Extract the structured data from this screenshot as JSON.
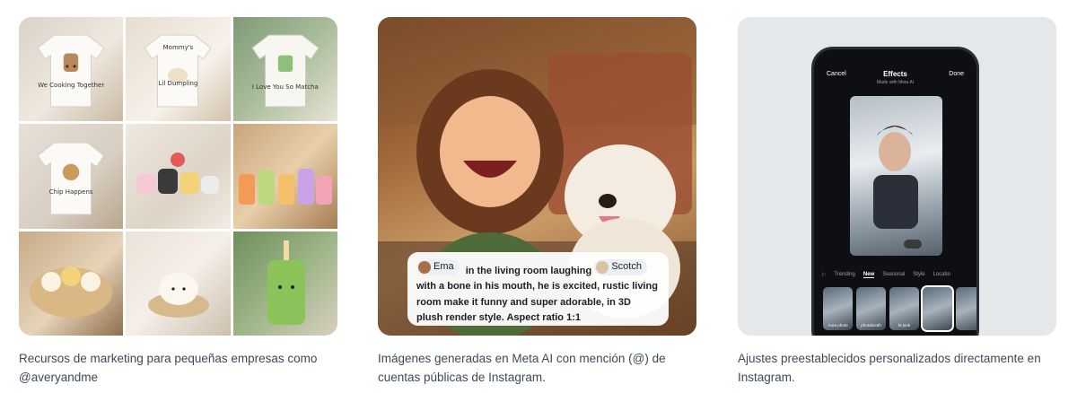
{
  "cards": [
    {
      "caption": "Recursos de marketing para pequeñas empresas como @averyandme",
      "tiles": [
        {
          "text_top": "",
          "text_bottom": "We Cooking Together"
        },
        {
          "text_top": "Mommy's",
          "text_bottom": "Lil Dumpling"
        },
        {
          "text_top": "",
          "text_bottom": "I Love You So Matcha"
        },
        {
          "text_top": "",
          "text_bottom": "Chip Happens"
        },
        {
          "text_top": "",
          "text_bottom": ""
        },
        {
          "text_top": "",
          "text_bottom": ""
        },
        {
          "text_top": "",
          "text_bottom": ""
        },
        {
          "text_top": "",
          "text_bottom": ""
        },
        {
          "text_top": "",
          "text_bottom": ""
        }
      ]
    },
    {
      "caption": "Imágenes generadas en Meta AI con mención (@) de cuentas públicas de Instagram.",
      "prompt": {
        "mention1": "Ema",
        "text1": "in the living room laughing",
        "mention2": "Scotch",
        "text2": "with a bone in his mouth, he is excited, rustic living room make it funny and super adorable, in 3D plush render style. Aspect ratio 1:1"
      }
    },
    {
      "caption": "Ajustes preestablecidos personalizados directamente en Instagram.",
      "phone": {
        "cancel": "Cancel",
        "title": "Effects",
        "subtitle": "Made with Meta AI",
        "done": "Done",
        "tabs": [
          "Trending",
          "New",
          "Seasonal",
          "Style",
          "Locatio"
        ],
        "active_tab": "New",
        "effects": [
          "Aura photo",
          "photobooth",
          "bt pink",
          "",
          ""
        ]
      }
    }
  ],
  "colors": {
    "caption_text": "#3c4a57",
    "phone_bg": "#e5e8eb",
    "phone_body": "#0e0f12"
  }
}
